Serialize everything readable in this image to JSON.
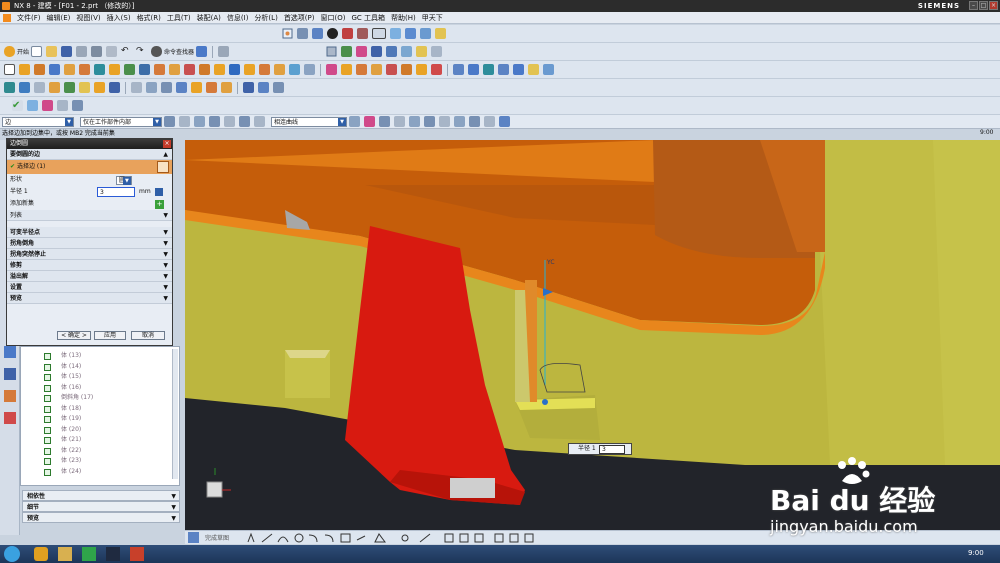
{
  "window": {
    "title": "NX 8 - 建模 - [F01 - 2.prt （修改的）]",
    "brand": "SIEMENS"
  },
  "menu": [
    "文件(F)",
    "编辑(E)",
    "视图(V)",
    "插入(S)",
    "格式(R)",
    "工具(T)",
    "装配(A)",
    "信息(I)",
    "分析(L)",
    "首选项(P)",
    "窗口(O)",
    "GC 工具箱",
    "帮助(H)",
    "甲天下"
  ],
  "toolbar": {
    "start_label": "开始",
    "command_finder_label": "命令查找器"
  },
  "filter_bar": {
    "type_filter": "边",
    "scope_filter": "仅在工作部件内部",
    "curve_rule": "相连曲线"
  },
  "status": {
    "prompt": "选择边加到边集中，或按 MB2 完成当前集",
    "clock": "9:00"
  },
  "dialog": {
    "title": "边倒圆",
    "section_edges": "要倒圆的边",
    "select_edge": "选择边 (1)",
    "shape_label": "形状",
    "shape_value": "圆形",
    "radius_label": "半径 1",
    "radius_value": "3",
    "radius_unit": "mm",
    "add_set_label": "添加新集",
    "list_label": "列表",
    "groups": [
      "可变半径点",
      "拐角倒角",
      "拐角突然停止",
      "修剪",
      "溢出解",
      "设置",
      "预览"
    ],
    "buttons": {
      "ok": "< 确定 >",
      "apply": "应用",
      "cancel": "取消"
    }
  },
  "tree": {
    "items": [
      {
        "label": "体 (13)"
      },
      {
        "label": "体 (14)"
      },
      {
        "label": "体 (15)"
      },
      {
        "label": "体 (16)"
      },
      {
        "label": "倒斜角 (17)"
      },
      {
        "label": "体 (18)"
      },
      {
        "label": "体 (19)"
      },
      {
        "label": "体 (20)"
      },
      {
        "label": "体 (21)"
      },
      {
        "label": "体 (22)"
      },
      {
        "label": "体 (23)"
      },
      {
        "label": "体 (24)"
      }
    ],
    "panels": [
      "相依性",
      "细节",
      "预览"
    ]
  },
  "viewport": {
    "axis_label": "YC",
    "radius_popup_label": "半径 1",
    "radius_popup_value": "3"
  },
  "sketch_toolbar": {
    "label": "完成草图"
  },
  "watermark": {
    "brand": "Bai du 经验",
    "url": "jingyan.baidu.com"
  }
}
